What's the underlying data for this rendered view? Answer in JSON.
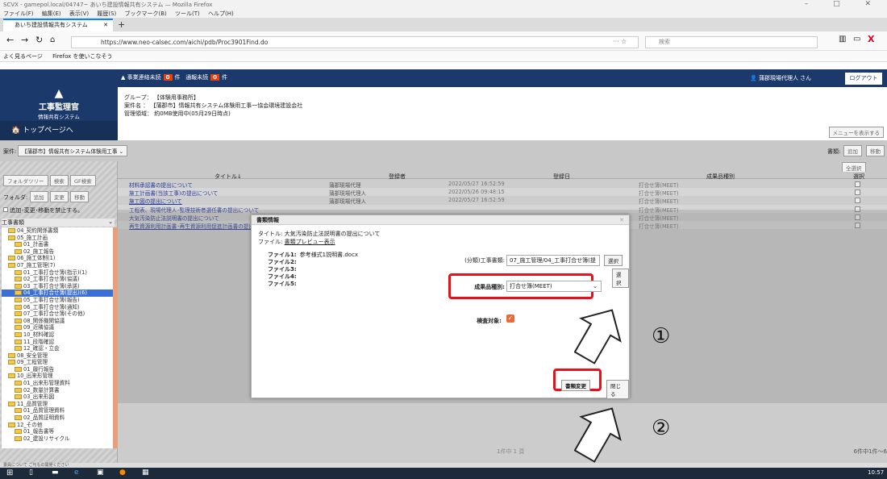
{
  "browser": {
    "title": "SCVX - gamepol.local/04747~ あいち建設情報共有システム — Mozilla Firefox",
    "menu": [
      "ファイル(F)",
      "編集(E)",
      "表示(V)",
      "履歴(S)",
      "ブックマーク(B)",
      "ツール(T)",
      "ヘルプ(H)"
    ],
    "tab": "あいち建設情報共有システム",
    "url": "https://www.neo-calsec.com/aichi/pdb/Proc3901Find.do",
    "search_placeholder": "検索",
    "bookmarks": [
      "よく見るページ",
      "Firefox を使いこなそう"
    ]
  },
  "header": {
    "alert1": "事業連絡未読",
    "alert1_count": "0",
    "alert1_unit": "件",
    "alert2": "通報未読",
    "alert2_count": "0",
    "alert2_unit": "件",
    "user": "蒲郡現場代理人 さん",
    "logout": "ログアウト",
    "logo_line1": "工事監理官",
    "logo_line2": "情報共有システム",
    "toppage": "トップページへ",
    "group_label": "グループ：",
    "group_value": "【体験用事務所】",
    "project_label": "案件名 ：",
    "project_value": "【蒲郡市】情報共有システム体験用工事一協会環境建設会社",
    "capacity_label": "管理領域：",
    "capacity_value": "約0MB使用中(05月29日時点)",
    "menu_btn": "メニューを表示する"
  },
  "toolbar": {
    "case_label": "案件:",
    "case_value": "【蒲郡市】情報共有システム体験用工事",
    "docs_label": "書類:",
    "add": "追加",
    "move": "移動",
    "select_all": "全選択"
  },
  "sidebar": {
    "tabs": [
      "フォルダツリー",
      "検索",
      "GF検索"
    ],
    "folder_label": "フォルダ:",
    "folder_buttons": [
      "追加",
      "変更",
      "移動"
    ],
    "restrict": "追加･変更･移動を禁止する。",
    "tree_header": "工事書類",
    "tree": [
      "04_契約関係書類",
      "05_施工計画",
      "01_計画書",
      "02_施工報告",
      "06_施工体制(1)",
      "07_施工管理(7)",
      "01_工事打合せ簿(指示)(1)",
      "02_工事打合せ簿(協議)",
      "03_工事打合せ簿(承諾)",
      "04_工事打合せ簿(提出)(6)",
      "05_工事打合せ簿(報告)",
      "06_工事打合せ簿(通知)",
      "07_工事打合せ簿(その他)",
      "08_関係機関協議",
      "09_近隣協議",
      "10_材料確認",
      "11_段階確認",
      "12_確認・立会",
      "08_安全管理",
      "09_工程管理",
      "01_履行報告",
      "10_出来形管理",
      "01_出来形管理資料",
      "02_数量計算書",
      "03_出来形図",
      "11_品質管理",
      "01_品質管理資料",
      "02_品質証明資料",
      "12_その他",
      "01_報告書等",
      "02_建設リサイクル"
    ]
  },
  "table": {
    "headers": [
      "タイトル↓",
      "登録者",
      "登録日",
      "成果品種別",
      "選択"
    ],
    "rows": [
      {
        "title": "材料承認書の提出について",
        "user": "蒲郡現場代理",
        "date": "2022/05/27 16:52:59",
        "kind": "打合せ簿(MEET)"
      },
      {
        "title": "施工計画書(当該工事)の提出について",
        "user": "蒲郡現場代理人",
        "date": "2022/05/26 09:48:15",
        "kind": "打合せ簿(MEET)"
      },
      {
        "title": "施工図の提出について",
        "user": "蒲郡現場代理人",
        "date": "2022/05/27 16:52:59",
        "kind": "打合せ簿(MEET)"
      },
      {
        "title": "工程表、現場代理人･監理技術者選任書の提出について",
        "user": "",
        "date": "",
        "kind": "打合せ簿(MEET)"
      },
      {
        "title": "大気汚染防止法説明書の提出について",
        "user": "",
        "date": "",
        "kind": "打合せ簿(MEET)"
      },
      {
        "title": "再生資源利用計画書･再生資源利用促進計画書の提出について",
        "user": "",
        "date": "",
        "kind": "打合せ簿(MEET)"
      }
    ],
    "pager": "1件中 1 頁",
    "count": "6件中1件～6"
  },
  "dialog": {
    "title": "書類情報",
    "doc_title_label": "タイトル:",
    "doc_title": "大気汚染防止法説明書の提出について",
    "file_label": "ファイル:",
    "file_link": "書類プレビュー表示",
    "files": [
      {
        "label": "ファイル1:",
        "value": "参考様式1説明書.docx"
      },
      {
        "label": "ファイル2:",
        "value": ""
      },
      {
        "label": "ファイル3:",
        "value": ""
      },
      {
        "label": "ファイル4:",
        "value": ""
      },
      {
        "label": "ファイル5:",
        "value": ""
      }
    ],
    "category_label": "(分類)工事書類:",
    "category_value": "07_施工管理/04_工事打合せ簿(提",
    "select_btn": "選択",
    "select_btn2": "選択",
    "kind_label": "成果品種別:",
    "kind_value": "打合せ簿(MEET)",
    "inspect_label": "検査対象:",
    "change_btn": "書類変更",
    "close_btn": "閉じる"
  },
  "annotations": {
    "num1": "①",
    "num2": "②"
  },
  "statusbar": "委員について ご与もの開発ください",
  "taskbar_time": "10:57"
}
